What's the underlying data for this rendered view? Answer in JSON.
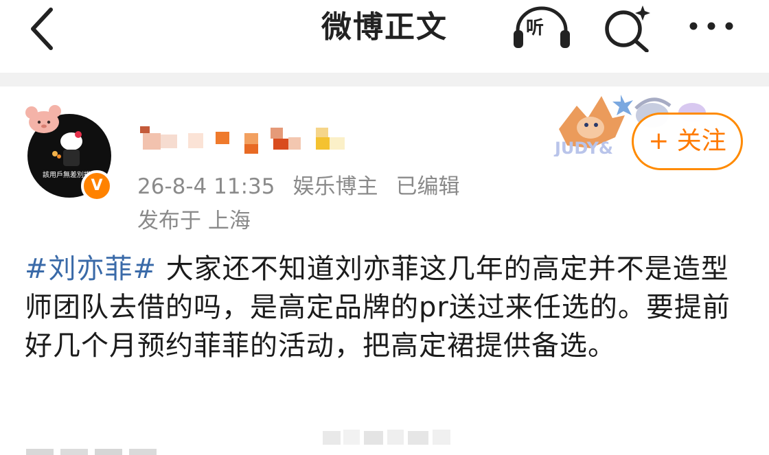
{
  "header": {
    "title": "微博正文",
    "listen_label": "听",
    "icons": {
      "back": "chevron-left-icon",
      "listen": "headphones-icon",
      "search": "search-sparkle-icon",
      "more": "more-dots-icon"
    }
  },
  "author": {
    "avatar_caption": "該用戶無差別撲",
    "verified_mark": "V",
    "meta": {
      "time": "26-8-4 11:35",
      "role": "娱乐博主",
      "edited": "已编辑"
    },
    "location": "发布于 上海",
    "follow_label": "+ 关注",
    "decor_text": "JUDY&"
  },
  "post": {
    "hashtag": "#刘亦菲#",
    "body": " 大家还不知道刘亦菲这几年的高定并不是造型师团队去借的吗，是高定品牌的pr送过来任选的。要提前好几个月预约菲菲的活动，把高定裙提供备选。"
  },
  "colors": {
    "accent": "#ff8200",
    "hashtag": "#3a6aa8",
    "meta": "#8a8a8a"
  }
}
